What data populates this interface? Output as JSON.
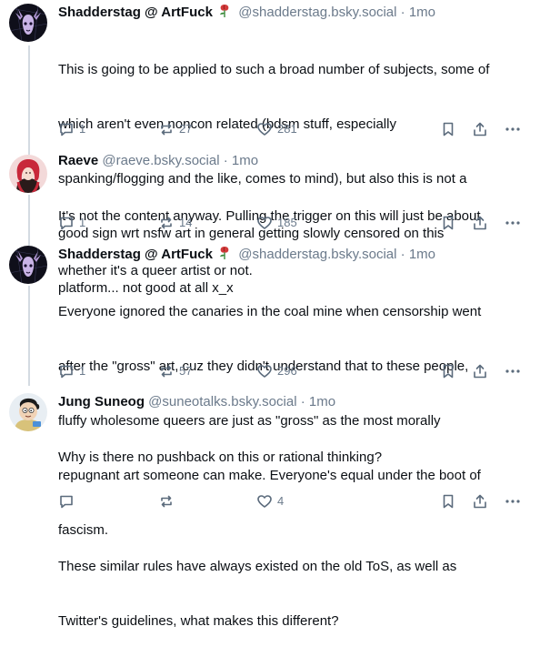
{
  "posts": [
    {
      "display_name": "Shadderstag @ ArtFuck",
      "badge_icon": "rose-icon",
      "handle": "@shadderstag.bsky.social",
      "separator": "·",
      "time": "1mo",
      "text_lines": [
        "This is going to be applied to such a broad number of subjects, some of",
        "which aren't even noncon related (bdsm stuff, especially",
        "spanking/flogging and the like, comes to mind), but also this is not a",
        "good sign wrt nsfw art in general getting slowly censored on this",
        "platform... not good at all x_x"
      ],
      "replies": "1",
      "reposts": "27",
      "likes": "281"
    },
    {
      "display_name": "Raeve",
      "handle": "@raeve.bsky.social",
      "separator": "·",
      "time": "1mo",
      "text_lines": [
        "It's not the content anyway. Pulling the trigger on this will just be about",
        "whether it's a queer artist or not."
      ],
      "replies": "1",
      "reposts": "14",
      "likes": "185"
    },
    {
      "display_name": "Shadderstag @ ArtFuck",
      "badge_icon": "rose-icon",
      "handle": "@shadderstag.bsky.social",
      "separator": "·",
      "time": "1mo",
      "text_lines": [
        "Everyone ignored the canaries in the coal mine when censorship went",
        "after the \"gross\" art, cuz they didn't understand that to these people,",
        "fluffy wholesome queers are just as \"gross\" as the most morally",
        "repugnant art someone can make. Everyone's equal under the boot of",
        "fascism."
      ],
      "replies": "1",
      "reposts": "57",
      "likes": "296"
    },
    {
      "display_name": "Jung Suneog",
      "handle": "@suneotalks.bsky.social",
      "separator": "·",
      "time": "1mo",
      "text_lines": [
        "Why is there no pushback on this or rational thinking?",
        "",
        "These similar rules have always existed on the old ToS, as well as",
        "Twitter's guidelines, what makes this different?"
      ],
      "replies": "",
      "reposts": "",
      "likes": "4"
    }
  ],
  "colors": {
    "text": "#0b0f14",
    "muted": "#6b7a8b",
    "thread_line": "#d4dbe2",
    "icon": "#5b6b7c"
  }
}
